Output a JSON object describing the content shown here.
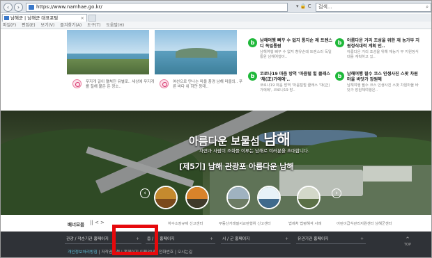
{
  "browser": {
    "url": "https://www.namhae.go.kr/",
    "addr_icons": "▾ 🔒 C",
    "search_placeholder": "검색...",
    "tab_title": "남해군 | 남해군 대표포털",
    "menu": [
      "파일(F)",
      "편집(E)",
      "보기(V)",
      "즐겨찾기(A)",
      "도구(T)",
      "도움말(H)"
    ]
  },
  "news": {
    "photo_captions": [
      "푸지개 길이 펼쳐진 유별로.. 세상에 무지개를 칠해 붙은 돈 장소..",
      "여선으로 만나는 마을 풍경 남해 마을의.. 푸른 바다 위 하얀 등대.."
    ],
    "blog": [
      {
        "badge": "b",
        "title": "남해여행 뻐꾸 수 없지 통지순 레 트렌스디 독일통원",
        "desc": "남해여행 뻐꾸 수 없지 향유순레 트렌스러 독일통원 남해여행이.."
      },
      {
        "badge": "b",
        "title": "아름다운 거리 조성을 위한 재 농가부 지원정식대적 계획 인..",
        "desc": "아름다운 거리 조성을 위해 재농가 부 지원정식대를 계획하고 있.."
      },
      {
        "badge": "b",
        "title": "코로나19 마음 방역 '마음털 힐 클래스 '채(正)가에에'..",
        "desc": "코로나19 마음 방역 '마음털힐 클래스 '채(正)가에에', 코로나19 방.."
      },
      {
        "badge": "b",
        "title": "남해여행 필수 코스 인생사진 스팟 차원마을 바닷가 장원해",
        "desc": "남해여행 필수 코스 인생사진 스팟 차원마을 바닷가 장원해여행은.."
      }
    ]
  },
  "hero": {
    "title_prefix": "아름다운 보물섬",
    "title_big": "남해",
    "subtitle": "자연과 사람이 조화를 이루는 남해로 여러분을 초대합니다.",
    "banner": "[제5기] 남해 관광포 아름다운 남해"
  },
  "banner_row": {
    "label": "배너모음",
    "controls": "|| < >",
    "links": [
      "하수소장규제 신고센터",
      "부동산거래질서교란행위 신고센터",
      "법제처 법령해석 사례",
      "어린이급식관리지원센터 남해군센터"
    ]
  },
  "footer": {
    "selects": [
      "관광 / 작순기관 홈페이지",
      "읍 / 면 홈페이지",
      "시 / 군 홈페이지",
      "유관기관 홈페이지"
    ],
    "links": [
      "개인정보처리방침",
      "저작권정책",
      "홈페이지 이용안내",
      "전화번호",
      "오시는길"
    ],
    "top_label": "TOP"
  }
}
